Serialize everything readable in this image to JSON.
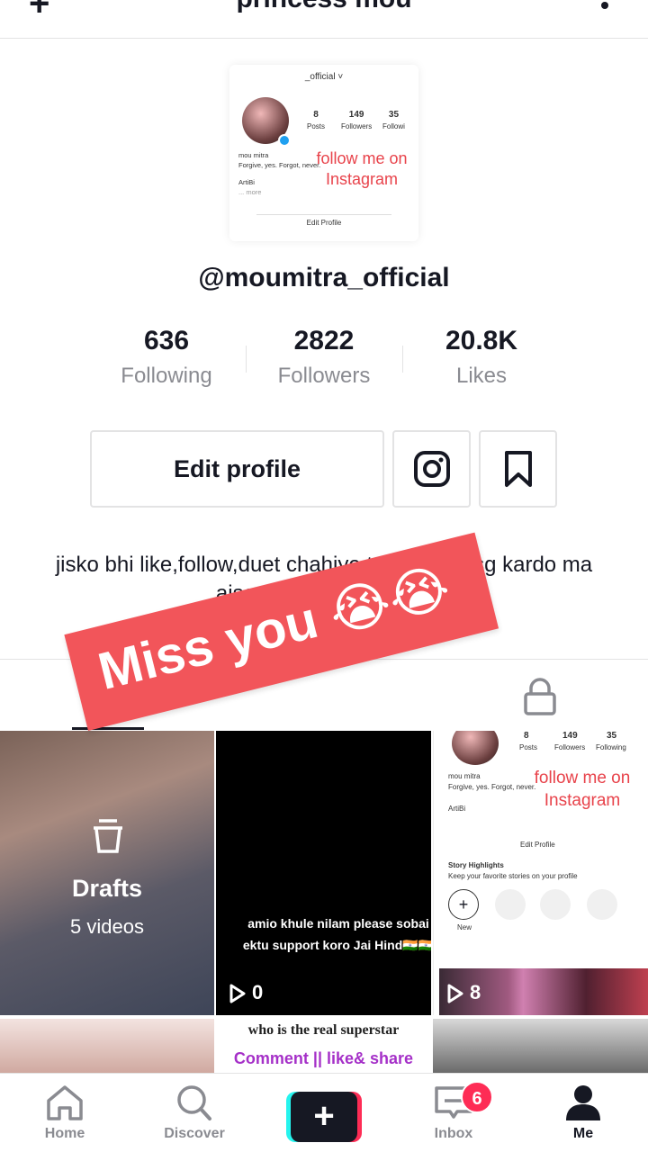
{
  "header": {
    "add_user_icon": "+",
    "title": "princess mou",
    "more_icon": "more-dots"
  },
  "embedded_profile": {
    "account": "_official ˅",
    "posts_value": "8",
    "posts_label": "Posts",
    "followers_value": "149",
    "followers_label": "Followers",
    "following_value": "35",
    "following_label": "Followi",
    "bio_line1": "mou mitra",
    "bio_line2": "Forgive, yes. Forgot, never.",
    "bio_line3": "ArtiBi",
    "bio_more": "... more",
    "follow_text": "follow me on Instagram",
    "edit_profile": "Edit Profile"
  },
  "profile": {
    "username": "@moumitra_official",
    "following_count": "636",
    "following_label": "Following",
    "followers_count": "2822",
    "followers_label": "Followers",
    "likes_count": "20.8K",
    "likes_label": "Likes",
    "edit_profile_label": "Edit profile",
    "bio": "jisko bhi like,follow,duet chahiye to mujhe msg kardo ma ajse only suprt karungi"
  },
  "overlay": {
    "banner_text": "Miss you 😭😭"
  },
  "videos": {
    "drafts_label": "Drafts",
    "drafts_count": "5 videos",
    "video2_caption": "amio khule nilam please sobai ektu support koro Jai Hind🇮🇳🇮🇳",
    "video2_plays": "0",
    "video3_follow": "follow me on Instagram",
    "video3_plays": "8",
    "video3_posts": "8",
    "video3_posts_label": "Posts",
    "video3_followers": "149",
    "video3_followers_label": "Followers",
    "video3_following": "35",
    "video3_following_label": "Following",
    "video3_bio1": "mou mitra",
    "video3_bio2": "Forgive, yes. Forgot, never.",
    "video3_bio3": "ArtiBi",
    "video3_edit": "Edit Profile",
    "video3_highlights": "Story Highlights",
    "video3_highlights_sub": "Keep your favorite stories on your profile",
    "video3_new": "New",
    "row2_video2_line1": "who is the real superstar",
    "row2_video2_line2": "Comment || like& share"
  },
  "nav": {
    "home": "Home",
    "discover": "Discover",
    "inbox": "Inbox",
    "inbox_badge": "6",
    "me": "Me"
  },
  "colors": {
    "accent": "#fe2c55",
    "cyan": "#25f4ee",
    "banner": "#f2555a",
    "text": "#161823",
    "secondary": "#8a8b91"
  }
}
